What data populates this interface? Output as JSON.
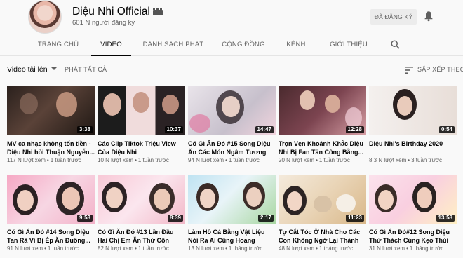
{
  "channel": {
    "name": "Diệu Nhi Official",
    "subscribers": "601 N người đăng ký",
    "subscribe_button": "ĐÃ ĐĂNG KÝ"
  },
  "tabs": [
    {
      "label": "TRANG CHỦ",
      "active": false
    },
    {
      "label": "VIDEO",
      "active": true
    },
    {
      "label": "DANH SÁCH PHÁT",
      "active": false
    },
    {
      "label": "CỘNG ĐỒNG",
      "active": false
    },
    {
      "label": "KÊNH",
      "active": false
    },
    {
      "label": "GIỚI THIỆU",
      "active": false
    }
  ],
  "toolbar": {
    "section": "Video tải lên",
    "play_all": "PHÁT TẤT CẢ",
    "sort": "SẮP XẾP THEO"
  },
  "videos": [
    {
      "title": "MV ca nhạc không tốn tiền - Diệu Nhi hỏi Thuận Nguyễn...",
      "views": "117 N lượt xem",
      "age": "1 tuần trước",
      "duration": "3:38"
    },
    {
      "title": "Các Clip Tiktok Triệu View Của Diệu Nhi",
      "views": "10 N lượt xem",
      "age": "1 tuần trước",
      "duration": "10:37"
    },
    {
      "title": "Có Gì Ăn Đó #15 Song Diệu Ăn Các Món Ngâm Tương V...",
      "views": "94 N lượt xem",
      "age": "1 tuần trước",
      "duration": "14:47"
    },
    {
      "title": "Trọn Vẹn Khoảnh Khắc Diệu Nhi Bị Fan Tấn Công Bằng...",
      "views": "20 N lượt xem",
      "age": "1 tuần trước",
      "duration": "12:28"
    },
    {
      "title": "Diệu Nhi's Birthday 2020",
      "views": "8,3 N lượt xem",
      "age": "3 tuần trước",
      "duration": "0:54"
    },
    {
      "title": "Có Gì Ăn Đó #14 Song Diệu Tan Rã Vì Bị Ép Ăn Đuông...",
      "views": "91 N lượt xem",
      "age": "1 tuần trước",
      "duration": "9:53"
    },
    {
      "title": "Có Gì Ăn Đó #13 Lần Đầu Hai Chị Em Ăn Thử Côn Trùng...",
      "views": "82 N lượt xem",
      "age": "1 tuần trước",
      "duration": "8:39"
    },
    {
      "title": "Làm Hồ Cá Bằng Vật Liệu Nói Ra Ai Cũng Hoang Mang...",
      "views": "13 N lượt xem",
      "age": "1 tháng trước",
      "duration": "2:17"
    },
    {
      "title": "Tự Cắt Tóc Ở Nhà Cho Các Con Không Ngờ Lại Thành R...",
      "views": "48 N lượt xem",
      "age": "1 tháng trước",
      "duration": "11:23"
    },
    {
      "title": "Có Gì Ăn Đó#12 Song Diệu Thử Thách Cùng Kẹo Thúi V...",
      "views": "31 N lượt xem",
      "age": "1 tháng trước",
      "duration": "13:58"
    }
  ],
  "colors": {
    "background": "#f9f9f9",
    "text_primary": "#030303",
    "text_secondary": "#606060",
    "subscribed_button_bg": "#ececec",
    "duration_badge_bg": "#000000"
  },
  "icons": {
    "channel_badge": "clapperboard-icon",
    "notifications": "bell-icon",
    "search": "search-icon",
    "sort": "sort-icon",
    "dropdown": "caret-down-icon"
  }
}
